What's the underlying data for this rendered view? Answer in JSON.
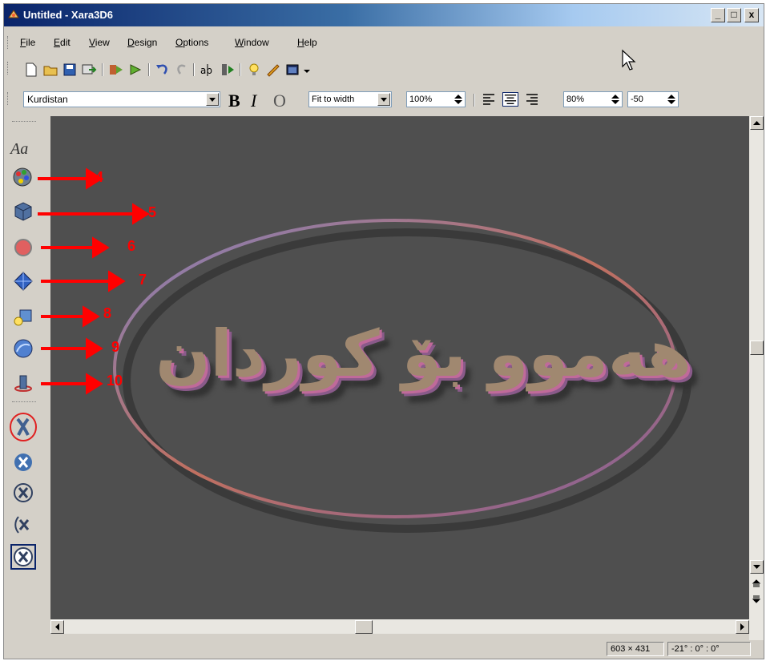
{
  "window": {
    "title": "Untitled - Xara3D6"
  },
  "title_buttons": {
    "minimize": "_",
    "maximize": "□",
    "close": "x"
  },
  "menu": [
    {
      "label": "File",
      "u": "F",
      "rest": "ile"
    },
    {
      "label": "Edit",
      "u": "E",
      "rest": "dit"
    },
    {
      "label": "View",
      "u": "V",
      "rest": "iew"
    },
    {
      "label": "Design",
      "u": "D",
      "rest": "esign"
    },
    {
      "label": "Options",
      "u": "O",
      "rest": "ptions"
    },
    {
      "label": "Window",
      "u": "W",
      "rest": "indow"
    },
    {
      "label": "Help",
      "u": "H",
      "rest": "elp"
    }
  ],
  "format_bar": {
    "font": "Kurdistan",
    "bold": "B",
    "italic": "I",
    "outline": "O",
    "fit": "Fit to width",
    "zoom": "100%",
    "line_spacing": "80%",
    "char_spacing": "-50"
  },
  "sidebar": {
    "text_tool": "Aa"
  },
  "canvas": {
    "text": "هەموو بۆ کوردان"
  },
  "annotations": [
    "4",
    "5",
    "6",
    "7",
    "8",
    "9",
    "10"
  ],
  "status": {
    "size": "603 × 431",
    "rotation": "-21° : 0° : 0°"
  },
  "colors": {
    "canvas": "#4f4f4f",
    "annotation": "#ff0000",
    "title_start": "#0a246a"
  }
}
